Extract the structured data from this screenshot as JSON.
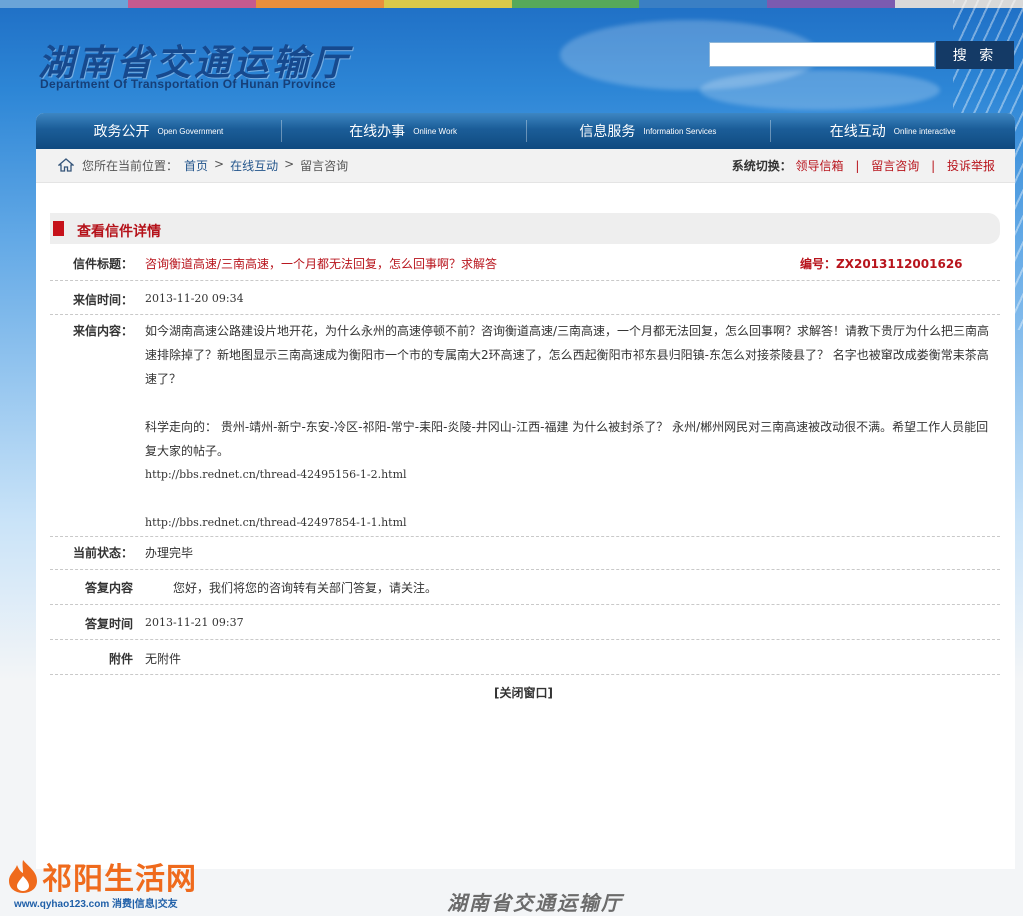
{
  "header": {
    "logo_cn": "湖南省交通运输厅",
    "logo_en": "Department Of Transportation Of Hunan Province",
    "search_value": "",
    "search_button": "搜 索"
  },
  "nav": [
    {
      "cn": "政务公开",
      "en": "Open Government"
    },
    {
      "cn": "在线办事",
      "en": "Online Work"
    },
    {
      "cn": "信息服务",
      "en": "Information Services"
    },
    {
      "cn": "在线互动",
      "en": "Online interactive"
    }
  ],
  "breadcrumb": {
    "prefix": "您所在当前位置：",
    "items": [
      "首页",
      "在线互动",
      "留言咨询"
    ],
    "separator": ">"
  },
  "system_switch": {
    "label": "系统切换：",
    "links": [
      "领导信箱",
      "留言咨询",
      "投诉举报"
    ],
    "separator": "|"
  },
  "letter": {
    "section_title": "查看信件详情",
    "title_label": "信件标题：",
    "title_value": "咨询衡道高速/三南高速，一个月都无法回复，怎么回事啊？求解答",
    "number_label": "编号：",
    "number_value": "ZX2013112001626",
    "time_label": "来信时间：",
    "time_value": "2013-11-20 09:34",
    "content_label": "来信内容：",
    "content_p1": "如今湖南高速公路建设片地开花，为什么永州的高速停顿不前？咨询衡道高速/三南高速，一个月都无法回复，怎么回事啊？求解答！请教下贵厅为什么把三南高速排除掉了？新地图显示三南高速成为衡阳市一个市的专属南大2环高速了，怎么西起衡阳市祁东县归阳镇-东怎么对接茶陵县了？ 名字也被窜改成娄衡常耒茶高速了？",
    "content_p2": "科学走向的： 贵州-靖州-新宁-东安-冷区-祁阳-常宁-耒阳-炎陵-井冈山-江西-福建 为什么被封杀了？ 永州/郴州网民对三南高速被改动很不满。希望工作人员能回复大家的帖子。",
    "content_link1": "http://bbs.rednet.cn/thread-42495156-1-2.html",
    "content_link2": "http://bbs.rednet.cn/thread-42497854-1-1.html",
    "status_label": "当前状态：",
    "status_value": "办理完毕",
    "reply_label": "答复内容",
    "reply_value": "您好，我们将您的咨询转有关部门答复，请关注。",
    "reply_time_label": "答复时间",
    "reply_time_value": "2013-11-21 09:37",
    "attach_label": "附件",
    "attach_value": "无附件",
    "close_link": "[关闭窗口]"
  },
  "footer": {
    "logo": "湖南省交通运输厅"
  },
  "watermark": {
    "name": "祁阳生活网",
    "sub": "www.qyhao123.com 消费|信息|交友"
  },
  "colors": {
    "nav_bg": "#1b5d98",
    "accent_red": "#b8141c",
    "link_blue": "#24568c"
  }
}
